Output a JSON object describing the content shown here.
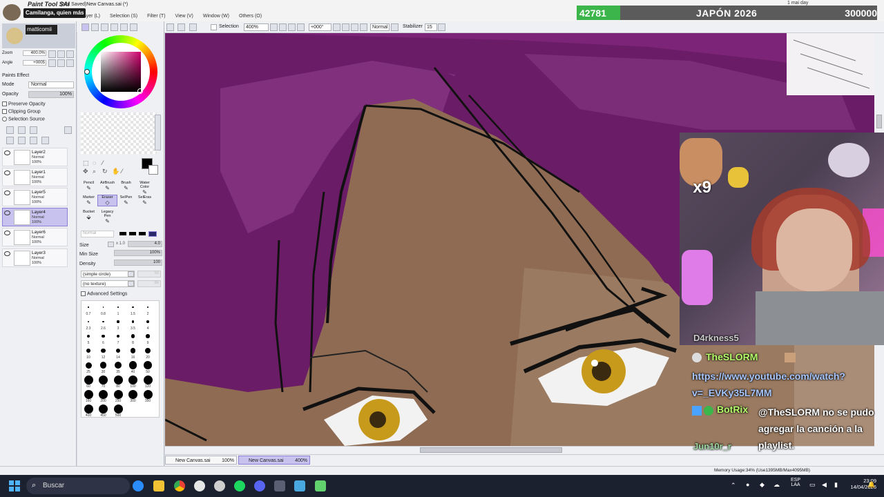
{
  "window": {
    "app_name": "Paint Tool SAI",
    "title": "(Not Saved)New Canvas.sai (*)",
    "tooltip": "Camilanga, quien más"
  },
  "menu": [
    "Layer (L)",
    "Selection (S)",
    "Filter (T)",
    "View (V)",
    "Window (W)",
    "Others (O)"
  ],
  "stream_goal": {
    "current": "42781",
    "title": "JAPÓN 2026",
    "target": "300000",
    "corner_text": "1 mai day"
  },
  "toolbar": {
    "selection_label": "Selection",
    "zoom": "400%",
    "rotation": "+000°",
    "blend_mode": "Normal",
    "stabilizer_label": "Stabilizer",
    "stabilizer_value": "15"
  },
  "navigator": {
    "user": "matticomii",
    "zoom_label": "Zoom",
    "zoom_value": "400.0%",
    "angle_label": "Angle",
    "angle_value": "+0005"
  },
  "layer_props": {
    "paint_effect": "Paints Effect",
    "mode_label": "Mode",
    "mode_value": "Normal",
    "opacity_label": "Opacity",
    "opacity_value": "100%",
    "preserve_opacity": "Preserve Opacity",
    "clipping_group": "Clipping Group",
    "selection_source": "Selection Source"
  },
  "layers": [
    {
      "name": "Layer2",
      "mode": "Normal",
      "opacity": "100%",
      "selected": false
    },
    {
      "name": "Layer1",
      "mode": "Normal",
      "opacity": "100%",
      "selected": false
    },
    {
      "name": "Layer5",
      "mode": "Normal",
      "opacity": "100%",
      "selected": false
    },
    {
      "name": "Layer4",
      "mode": "Normal",
      "opacity": "100%",
      "selected": true
    },
    {
      "name": "Layer6",
      "mode": "Normal",
      "opacity": "100%",
      "selected": false
    },
    {
      "name": "Layer3",
      "mode": "Normal",
      "opacity": "100%",
      "selected": false
    }
  ],
  "tools": [
    {
      "label": "Pencil",
      "icon": "pencil-icon"
    },
    {
      "label": "AirBrush",
      "icon": "airbrush-icon"
    },
    {
      "label": "Brush",
      "icon": "brush-icon"
    },
    {
      "label": "Water Color",
      "icon": "watercolor-icon"
    },
    {
      "label": "Marker",
      "icon": "marker-icon"
    },
    {
      "label": "Eraser",
      "icon": "eraser-icon"
    },
    {
      "label": "SelPen",
      "icon": "selpen-icon"
    },
    {
      "label": "SelEras",
      "icon": "seleras-icon"
    },
    {
      "label": "Bucket",
      "icon": "bucket-icon"
    },
    {
      "label": "Legacy Pen",
      "icon": "legacy-pen-icon"
    }
  ],
  "brush": {
    "mode": "Normal",
    "size_label": "Size",
    "size_mult": "x 1.0",
    "size_value": "4.0",
    "min_size_label": "Min Size",
    "min_size_value": "100%",
    "density_label": "Density",
    "density_value": "100",
    "shape": "(simple circle)",
    "shape_value": "50",
    "texture": "(no texture)",
    "texture_value": "95",
    "advanced": "Advanced Settings"
  },
  "brush_sizes": [
    "0.7",
    "0.8",
    "1",
    "1.5",
    "2",
    "2.3",
    "2.6",
    "3",
    "3.5",
    "4",
    "5",
    "6",
    "7",
    "8",
    "9",
    "10",
    "12",
    "14",
    "16",
    "20",
    "25",
    "30",
    "35",
    "40",
    "50",
    "60",
    "70",
    "80",
    "100",
    "120",
    "160",
    "200",
    "250",
    "300",
    "350",
    "400",
    "450",
    "500"
  ],
  "tabs": [
    {
      "label": "New Canvas.sai",
      "zoom": "100%",
      "selected": false
    },
    {
      "label": "New Canvas.sai",
      "zoom": "400%",
      "selected": true
    }
  ],
  "status": {
    "memory": "Memory Usage:34% (Use1395MB/Max4095MB)"
  },
  "chat": [
    {
      "user": "D4rkness5",
      "message": ""
    },
    {
      "user": "TheSLORM",
      "message": ""
    },
    {
      "user": "",
      "message": "https://www.youtube.com/watch?v=_EVKy35L7MM"
    },
    {
      "user": "BotRix",
      "message": "@TheSLORM no se pudo agregar la canción a la playlist."
    },
    {
      "user": "Jun10r_r",
      "message": ""
    }
  ],
  "emote_count": "x9",
  "taskbar": {
    "search_placeholder": "Buscar",
    "lang": "ESP",
    "lang_sub": "LAA",
    "time": "23:09",
    "date": "14/04/2026"
  }
}
